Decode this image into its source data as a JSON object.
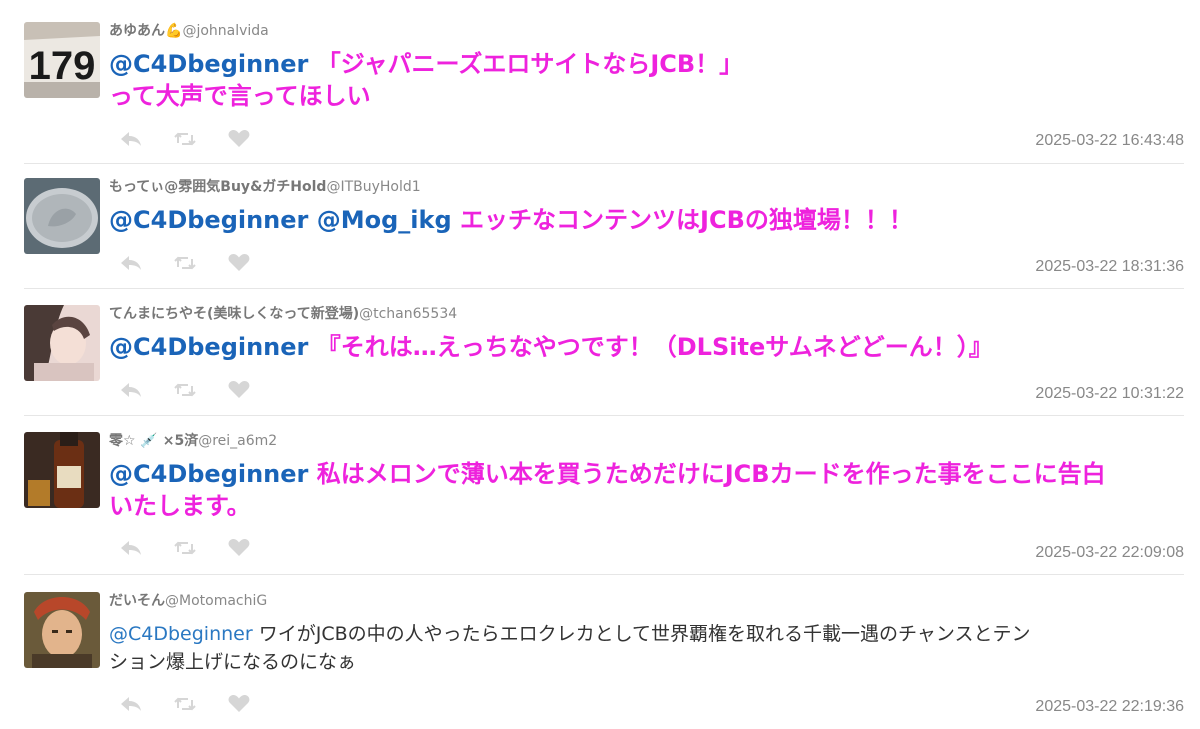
{
  "tweets": [
    {
      "user_name": "あゆあん",
      "user_emoji": "💪",
      "handle": "@johnalvida",
      "mentions": [
        "@C4Dbeginner"
      ],
      "text_line1": "「ジャパニーズエロサイトならJCB！」",
      "text_line2": "って大声で言ってほしい",
      "timestamp": "2025-03-22 16:43:48",
      "avatar_label": "179"
    },
    {
      "user_name": "もってぃ@雰囲気Buy&ガチHold",
      "user_emoji": "",
      "handle": "@ITBuyHold1",
      "mentions": [
        "@C4Dbeginner",
        "@Mog_ikg"
      ],
      "text_line1": "エッチなコンテンツはJCBの独壇場！！！",
      "text_line2": "",
      "timestamp": "2025-03-22 18:31:36"
    },
    {
      "user_name": "てんまにちやそ(美味しくなって新登場)",
      "user_emoji": "",
      "handle": "@tchan65534",
      "mentions": [
        "@C4Dbeginner"
      ],
      "text_line1": "『それは…えっちなやつです！（DLSiteサムネどどーん！）』",
      "text_line2": "",
      "timestamp": "2025-03-22 10:31:22"
    },
    {
      "user_name": "零☆ 💉 ×5済",
      "user_emoji": "",
      "handle": "@rei_a6m2",
      "mentions": [
        "@C4Dbeginner"
      ],
      "text_line1": "私はメロンで薄い本を買うためだけにJCBカードを作った事をここに告白",
      "text_line2": "いたします。",
      "timestamp": "2025-03-22 22:09:08"
    },
    {
      "user_name": "だいそん",
      "user_emoji": "",
      "handle": "@MotomachiG",
      "mentions": [
        "@C4Dbeginner"
      ],
      "text_line1": "ワイがJCBの中の人やったらエロクレカとして世界覇権を取れる千載一遇のチャンスとテン",
      "text_line2": "ション爆上げになるのになぁ",
      "timestamp": "2025-03-22 22:19:36"
    }
  ],
  "icons": {
    "reply": "reply-icon",
    "retweet": "retweet-icon",
    "like": "heart-icon"
  },
  "colors": {
    "highlight_text": "#ee22dd",
    "mention": "#1a64b8",
    "timestamp": "#888888"
  }
}
